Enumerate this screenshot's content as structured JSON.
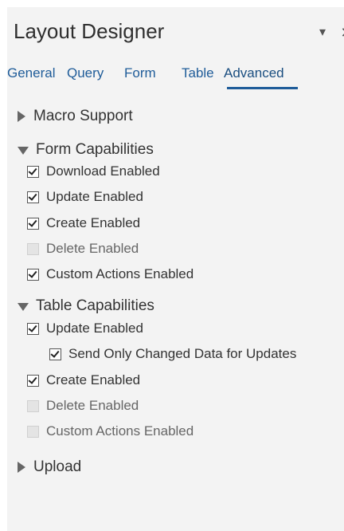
{
  "header": {
    "title": "Layout Designer",
    "minimize_glyph": "▾",
    "close_glyph": "✕"
  },
  "tabs": [
    {
      "label": "General",
      "active": false
    },
    {
      "label": "Query",
      "active": false
    },
    {
      "label": "Form",
      "active": false
    },
    {
      "label": "Table",
      "active": false
    },
    {
      "label": "Advanced",
      "active": true
    }
  ],
  "sections": {
    "macro": {
      "label": "Macro Support",
      "expanded": false
    },
    "form": {
      "label": "Form Capabilities",
      "expanded": true,
      "options": [
        {
          "label": "Download Enabled",
          "checked": true,
          "disabled": false
        },
        {
          "label": "Update Enabled",
          "checked": true,
          "disabled": false
        },
        {
          "label": "Create Enabled",
          "checked": true,
          "disabled": false
        },
        {
          "label": "Delete Enabled",
          "checked": false,
          "disabled": true
        },
        {
          "label": "Custom Actions Enabled",
          "checked": true,
          "disabled": false
        }
      ]
    },
    "table": {
      "label": "Table Capabilities",
      "expanded": true,
      "options": [
        {
          "label": "Update Enabled",
          "checked": true,
          "disabled": false
        },
        {
          "label": "Send Only Changed Data for Updates",
          "checked": true,
          "disabled": false
        },
        {
          "label": "Create Enabled",
          "checked": true,
          "disabled": false
        },
        {
          "label": "Delete Enabled",
          "checked": false,
          "disabled": true
        },
        {
          "label": "Custom Actions Enabled",
          "checked": false,
          "disabled": true
        }
      ]
    },
    "upload": {
      "label": "Upload",
      "expanded": false
    }
  },
  "colors": {
    "accent": "#1f5c99",
    "panel_bg": "#f3f3f3"
  }
}
